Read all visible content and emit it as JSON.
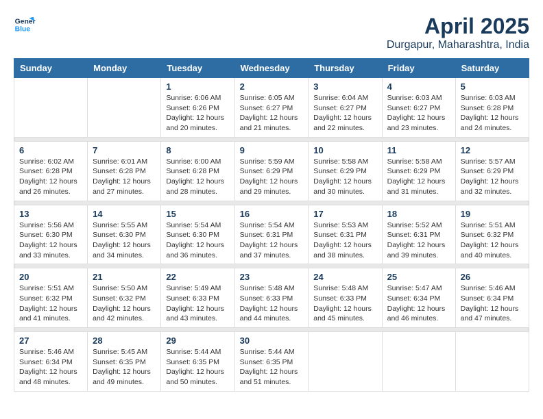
{
  "logo": {
    "line1": "General",
    "line2": "Blue"
  },
  "title": "April 2025",
  "location": "Durgapur, Maharashtra, India",
  "weekdays": [
    "Sunday",
    "Monday",
    "Tuesday",
    "Wednesday",
    "Thursday",
    "Friday",
    "Saturday"
  ],
  "weeks": [
    [
      {
        "day": "",
        "info": ""
      },
      {
        "day": "",
        "info": ""
      },
      {
        "day": "1",
        "info": "Sunrise: 6:06 AM\nSunset: 6:26 PM\nDaylight: 12 hours and 20 minutes."
      },
      {
        "day": "2",
        "info": "Sunrise: 6:05 AM\nSunset: 6:27 PM\nDaylight: 12 hours and 21 minutes."
      },
      {
        "day": "3",
        "info": "Sunrise: 6:04 AM\nSunset: 6:27 PM\nDaylight: 12 hours and 22 minutes."
      },
      {
        "day": "4",
        "info": "Sunrise: 6:03 AM\nSunset: 6:27 PM\nDaylight: 12 hours and 23 minutes."
      },
      {
        "day": "5",
        "info": "Sunrise: 6:03 AM\nSunset: 6:28 PM\nDaylight: 12 hours and 24 minutes."
      }
    ],
    [
      {
        "day": "6",
        "info": "Sunrise: 6:02 AM\nSunset: 6:28 PM\nDaylight: 12 hours and 26 minutes."
      },
      {
        "day": "7",
        "info": "Sunrise: 6:01 AM\nSunset: 6:28 PM\nDaylight: 12 hours and 27 minutes."
      },
      {
        "day": "8",
        "info": "Sunrise: 6:00 AM\nSunset: 6:28 PM\nDaylight: 12 hours and 28 minutes."
      },
      {
        "day": "9",
        "info": "Sunrise: 5:59 AM\nSunset: 6:29 PM\nDaylight: 12 hours and 29 minutes."
      },
      {
        "day": "10",
        "info": "Sunrise: 5:58 AM\nSunset: 6:29 PM\nDaylight: 12 hours and 30 minutes."
      },
      {
        "day": "11",
        "info": "Sunrise: 5:58 AM\nSunset: 6:29 PM\nDaylight: 12 hours and 31 minutes."
      },
      {
        "day": "12",
        "info": "Sunrise: 5:57 AM\nSunset: 6:29 PM\nDaylight: 12 hours and 32 minutes."
      }
    ],
    [
      {
        "day": "13",
        "info": "Sunrise: 5:56 AM\nSunset: 6:30 PM\nDaylight: 12 hours and 33 minutes."
      },
      {
        "day": "14",
        "info": "Sunrise: 5:55 AM\nSunset: 6:30 PM\nDaylight: 12 hours and 34 minutes."
      },
      {
        "day": "15",
        "info": "Sunrise: 5:54 AM\nSunset: 6:30 PM\nDaylight: 12 hours and 36 minutes."
      },
      {
        "day": "16",
        "info": "Sunrise: 5:54 AM\nSunset: 6:31 PM\nDaylight: 12 hours and 37 minutes."
      },
      {
        "day": "17",
        "info": "Sunrise: 5:53 AM\nSunset: 6:31 PM\nDaylight: 12 hours and 38 minutes."
      },
      {
        "day": "18",
        "info": "Sunrise: 5:52 AM\nSunset: 6:31 PM\nDaylight: 12 hours and 39 minutes."
      },
      {
        "day": "19",
        "info": "Sunrise: 5:51 AM\nSunset: 6:32 PM\nDaylight: 12 hours and 40 minutes."
      }
    ],
    [
      {
        "day": "20",
        "info": "Sunrise: 5:51 AM\nSunset: 6:32 PM\nDaylight: 12 hours and 41 minutes."
      },
      {
        "day": "21",
        "info": "Sunrise: 5:50 AM\nSunset: 6:32 PM\nDaylight: 12 hours and 42 minutes."
      },
      {
        "day": "22",
        "info": "Sunrise: 5:49 AM\nSunset: 6:33 PM\nDaylight: 12 hours and 43 minutes."
      },
      {
        "day": "23",
        "info": "Sunrise: 5:48 AM\nSunset: 6:33 PM\nDaylight: 12 hours and 44 minutes."
      },
      {
        "day": "24",
        "info": "Sunrise: 5:48 AM\nSunset: 6:33 PM\nDaylight: 12 hours and 45 minutes."
      },
      {
        "day": "25",
        "info": "Sunrise: 5:47 AM\nSunset: 6:34 PM\nDaylight: 12 hours and 46 minutes."
      },
      {
        "day": "26",
        "info": "Sunrise: 5:46 AM\nSunset: 6:34 PM\nDaylight: 12 hours and 47 minutes."
      }
    ],
    [
      {
        "day": "27",
        "info": "Sunrise: 5:46 AM\nSunset: 6:34 PM\nDaylight: 12 hours and 48 minutes."
      },
      {
        "day": "28",
        "info": "Sunrise: 5:45 AM\nSunset: 6:35 PM\nDaylight: 12 hours and 49 minutes."
      },
      {
        "day": "29",
        "info": "Sunrise: 5:44 AM\nSunset: 6:35 PM\nDaylight: 12 hours and 50 minutes."
      },
      {
        "day": "30",
        "info": "Sunrise: 5:44 AM\nSunset: 6:35 PM\nDaylight: 12 hours and 51 minutes."
      },
      {
        "day": "",
        "info": ""
      },
      {
        "day": "",
        "info": ""
      },
      {
        "day": "",
        "info": ""
      }
    ]
  ]
}
